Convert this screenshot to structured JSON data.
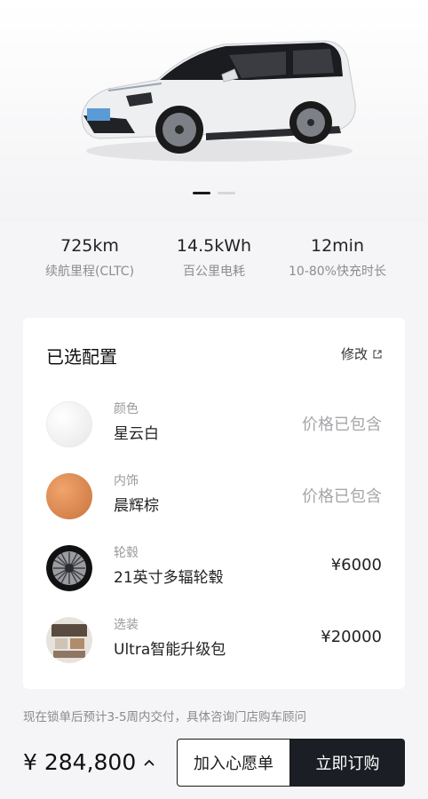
{
  "carousel": {
    "image_alt": "",
    "active_index": 0,
    "count": 2
  },
  "stats": [
    {
      "value": "725km",
      "label": "续航里程(CLTC)"
    },
    {
      "value": "14.5kWh",
      "label": "百公里电耗"
    },
    {
      "value": "12min",
      "label": "10-80%快充时长"
    }
  ],
  "config": {
    "title": "已选配置",
    "modify_label": "修改",
    "items": [
      {
        "category": "颜色",
        "name": "星云白",
        "price": "价格已包含",
        "icon": "white-color-swatch"
      },
      {
        "category": "内饰",
        "name": "晨辉棕",
        "price": "价格已包含",
        "icon": "brown-color-swatch"
      },
      {
        "category": "轮毂",
        "name": "21英寸多辐轮毂",
        "price": "¥6000",
        "icon": "wheel-image"
      },
      {
        "category": "选装",
        "name": "Ultra智能升级包",
        "price": "¥20000",
        "icon": "package-image"
      }
    ]
  },
  "footer": {
    "note": "现在锁单后预计3-5周内交付，具体咨询门店购车顾问",
    "total": "¥ 284,800",
    "wishlist_label": "加入心愿单",
    "buy_label": "立即订购"
  },
  "colors": {
    "buy_button_bg": "#1b1e24",
    "swatch_white": "#f2f2f2",
    "swatch_brown": "#d98a55"
  }
}
